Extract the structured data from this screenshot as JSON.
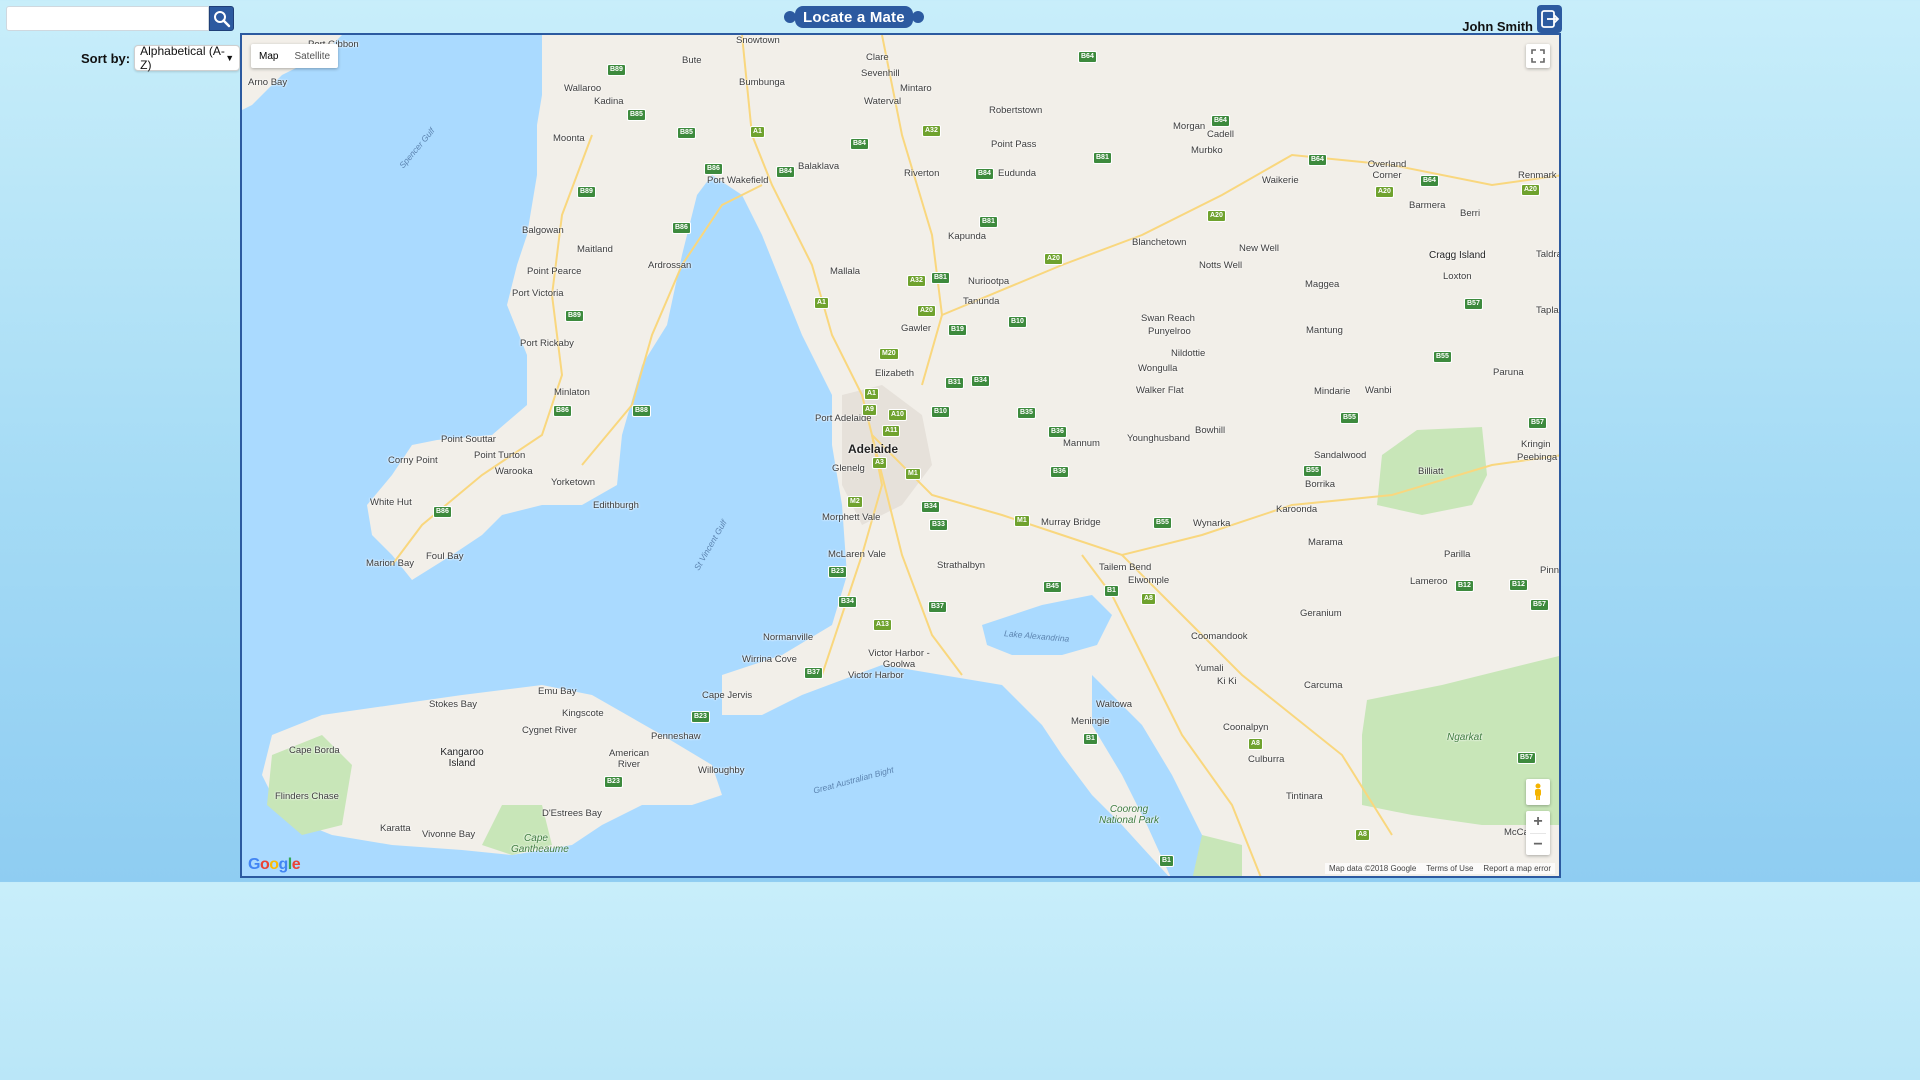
{
  "search": {
    "placeholder": "",
    "value": ""
  },
  "sort": {
    "label": "Sort by:",
    "selected": "Alphabetical (A-Z)"
  },
  "header": {
    "title": "Locate a Mate",
    "user_name": "John Smith"
  },
  "map": {
    "type_control": {
      "map": "Map",
      "satellite": "Satellite",
      "selected": "Map"
    },
    "attribution": {
      "data": "Map data ©2018 Google",
      "terms": "Terms of Use",
      "report": "Report a map error"
    },
    "logo": "Google",
    "places": [
      {
        "name": "Port Gibbon"
      },
      {
        "name": "Arno Bay"
      },
      {
        "name": "Wallaroo"
      },
      {
        "name": "Kadina"
      },
      {
        "name": "Bute"
      },
      {
        "name": "Moonta"
      },
      {
        "name": "Port Wakefield"
      },
      {
        "name": "Balaklava"
      },
      {
        "name": "Balgowan"
      },
      {
        "name": "Maitland"
      },
      {
        "name": "Ardrossan"
      },
      {
        "name": "Point Pearce"
      },
      {
        "name": "Port Victoria"
      },
      {
        "name": "Port Rickaby"
      },
      {
        "name": "Minlaton"
      },
      {
        "name": "Point Souttar"
      },
      {
        "name": "Corny Point"
      },
      {
        "name": "Point Turton"
      },
      {
        "name": "Warooka"
      },
      {
        "name": "Yorketown"
      },
      {
        "name": "Edithburgh"
      },
      {
        "name": "White Hut"
      },
      {
        "name": "Marion Bay"
      },
      {
        "name": "Foul Bay"
      },
      {
        "name": "Snowtown"
      },
      {
        "name": "Bumbunga"
      },
      {
        "name": "Clare"
      },
      {
        "name": "Sevenhill"
      },
      {
        "name": "Mintaro"
      },
      {
        "name": "Waterval"
      },
      {
        "name": "Robertstown"
      },
      {
        "name": "Point Pass"
      },
      {
        "name": "Riverton"
      },
      {
        "name": "Eudunda"
      },
      {
        "name": "Kapunda"
      },
      {
        "name": "Mallala"
      },
      {
        "name": "Nuriootpa"
      },
      {
        "name": "Tanunda"
      },
      {
        "name": "Gawler"
      },
      {
        "name": "Elizabeth"
      },
      {
        "name": "Port Adelaide"
      },
      {
        "name": "Adelaide"
      },
      {
        "name": "Glenelg"
      },
      {
        "name": "Morphett Vale"
      },
      {
        "name": "McLaren Vale"
      },
      {
        "name": "Strathalbyn"
      },
      {
        "name": "Murray Bridge"
      },
      {
        "name": "Mannum"
      },
      {
        "name": "Younghusband"
      },
      {
        "name": "Normanville"
      },
      {
        "name": "Wirrina Cove"
      },
      {
        "name": "Victor Harbor - Goolwa"
      },
      {
        "name": "Victor Harbor"
      },
      {
        "name": "Cape Jervis"
      },
      {
        "name": "Emu Bay"
      },
      {
        "name": "Stokes Bay"
      },
      {
        "name": "Kingscote"
      },
      {
        "name": "Cygnet River"
      },
      {
        "name": "Penneshaw"
      },
      {
        "name": "American River"
      },
      {
        "name": "Willoughby"
      },
      {
        "name": "Cape Borda"
      },
      {
        "name": "Kangaroo Island"
      },
      {
        "name": "Flinders Chase"
      },
      {
        "name": "Karatta"
      },
      {
        "name": "Vivonne Bay"
      },
      {
        "name": "Cape Gantheaume"
      },
      {
        "name": "D'Estrees Bay"
      },
      {
        "name": "Morgan"
      },
      {
        "name": "Cadell"
      },
      {
        "name": "Murbko"
      },
      {
        "name": "Waikerie"
      },
      {
        "name": "Overland Corner"
      },
      {
        "name": "Barmera"
      },
      {
        "name": "Berri"
      },
      {
        "name": "Renmark"
      },
      {
        "name": "Blanchetown"
      },
      {
        "name": "New Well"
      },
      {
        "name": "Notts Well"
      },
      {
        "name": "Cragg Island"
      },
      {
        "name": "Loxton"
      },
      {
        "name": "Maggea"
      },
      {
        "name": "Swan Reach"
      },
      {
        "name": "Punyelroo"
      },
      {
        "name": "Nildottie"
      },
      {
        "name": "Mantung"
      },
      {
        "name": "Wongulla"
      },
      {
        "name": "Walker Flat"
      },
      {
        "name": "Mindarie"
      },
      {
        "name": "Wanbi"
      },
      {
        "name": "Paruna"
      },
      {
        "name": "Bowhill"
      },
      {
        "name": "Sandalwood"
      },
      {
        "name": "Borrika"
      },
      {
        "name": "Billiatt"
      },
      {
        "name": "Kringin"
      },
      {
        "name": "Peebinga"
      },
      {
        "name": "Wynarka"
      },
      {
        "name": "Karoonda"
      },
      {
        "name": "Marama"
      },
      {
        "name": "Parilla"
      },
      {
        "name": "Tailem Bend"
      },
      {
        "name": "Elwomple"
      },
      {
        "name": "Lameroo"
      },
      {
        "name": "Geranium"
      },
      {
        "name": "Coomandook"
      },
      {
        "name": "Yumali"
      },
      {
        "name": "Ki Ki"
      },
      {
        "name": "Carcuma"
      },
      {
        "name": "Waltowa"
      },
      {
        "name": "Meningie"
      },
      {
        "name": "Coonalpyn"
      },
      {
        "name": "Culburra"
      },
      {
        "name": "Tintinara"
      },
      {
        "name": "Ngarkat"
      },
      {
        "name": "McCallum"
      },
      {
        "name": "Coorong National Park"
      },
      {
        "name": "Taldra"
      },
      {
        "name": "Taplan"
      },
      {
        "name": "Pinna"
      }
    ],
    "water_labels": [
      "Spencer Gulf",
      "St Vincent Gulf",
      "Great Australian Bight",
      "Lake Alexandrina"
    ]
  }
}
